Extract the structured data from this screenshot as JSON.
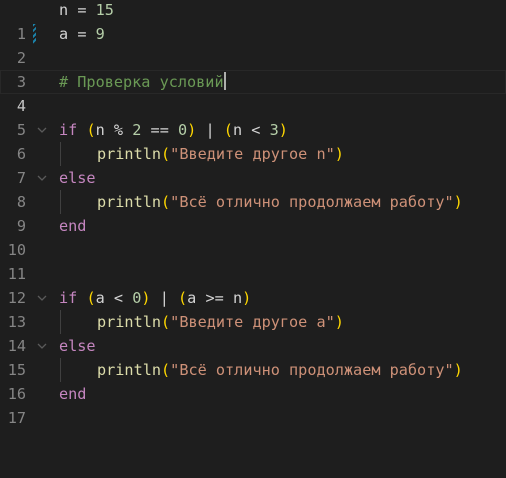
{
  "editor": {
    "lines": [
      {
        "num": "1",
        "tokens": [
          "n",
          "=",
          "15"
        ]
      },
      {
        "num": "2",
        "tokens": [
          "a",
          "=",
          "9"
        ]
      },
      {
        "num": "3",
        "tokens": []
      },
      {
        "num": "4",
        "tokens": [
          "# Проверка условий"
        ]
      },
      {
        "num": "5",
        "tokens": []
      },
      {
        "num": "6",
        "tokens": [
          "if",
          "(",
          "n",
          "%",
          "2",
          "==",
          "0",
          ")",
          "|",
          "(",
          "n",
          "<",
          "3",
          ")"
        ]
      },
      {
        "num": "7",
        "tokens": [
          "println",
          "(",
          "\"Введите другое n\"",
          ")"
        ]
      },
      {
        "num": "8",
        "tokens": [
          "else"
        ]
      },
      {
        "num": "9",
        "tokens": [
          "println",
          "(",
          "\"Всё отлично продолжаем работу\"",
          ")"
        ]
      },
      {
        "num": "10",
        "tokens": [
          "end"
        ]
      },
      {
        "num": "11",
        "tokens": []
      },
      {
        "num": "12",
        "tokens": []
      },
      {
        "num": "13",
        "tokens": [
          "if",
          "(",
          "a",
          "<",
          "0",
          ")",
          "|",
          "(",
          "a",
          ">=",
          "n",
          ")"
        ]
      },
      {
        "num": "14",
        "tokens": [
          "println",
          "(",
          "\"Введите другое a\"",
          ")"
        ]
      },
      {
        "num": "15",
        "tokens": [
          "else"
        ]
      },
      {
        "num": "16",
        "tokens": [
          "println",
          "(",
          "\"Всё отлично продолжаем работу\"",
          ")"
        ]
      },
      {
        "num": "17",
        "tokens": [
          "end"
        ]
      }
    ]
  },
  "colors": {
    "background": "#1e1e1e",
    "keyword": "#c586c0",
    "function": "#dcdcaa",
    "string": "#ce9178",
    "number": "#b5cea8",
    "comment": "#6a9955",
    "bracket_outer": "#ffd700",
    "bracket_inner": "#da70d6"
  },
  "icons": {
    "fold": "chevron-down-icon",
    "modified": "modified-line-marker"
  }
}
